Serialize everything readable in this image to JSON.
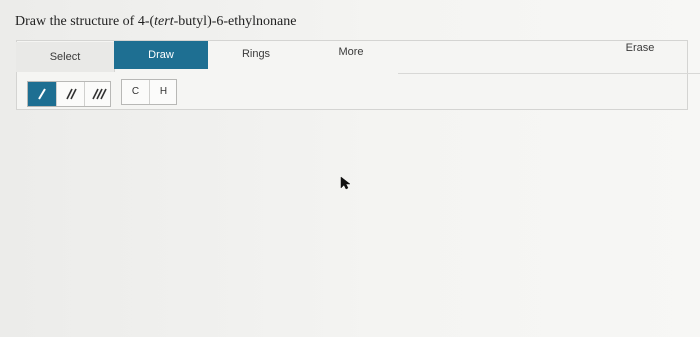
{
  "question": {
    "prefix": "Draw the structure of 4-(",
    "italic": "tert",
    "suffix": "-butyl)-6-ethylnonane"
  },
  "tabs": {
    "select": "Select",
    "draw": "Draw",
    "rings": "Rings",
    "more": "More",
    "erase": "Erase"
  },
  "bonds": {
    "single_icon": "single-bond-icon",
    "double_icon": "double-bond-icon",
    "triple_icon": "triple-bond-icon"
  },
  "atoms": {
    "c": "C",
    "h": "H"
  },
  "colors": {
    "accent": "#1e6f92",
    "background": "#f4f4f2"
  },
  "cursor_icon": "arrow-cursor-icon"
}
